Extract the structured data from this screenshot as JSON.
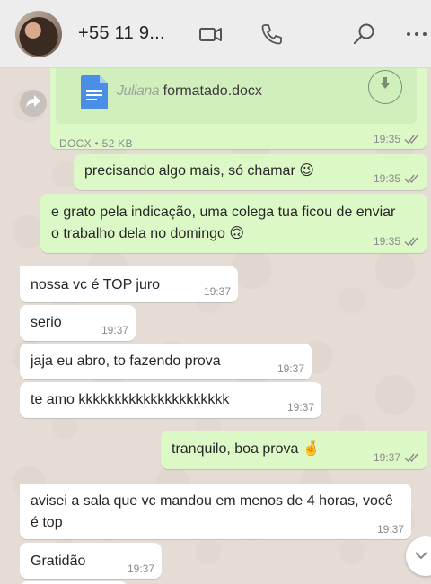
{
  "header": {
    "contact_name": "+55 11 9...",
    "icons": [
      "video-call-icon",
      "voice-call-icon",
      "search-icon",
      "menu-icon"
    ]
  },
  "document": {
    "name_hidden": "Juliana",
    "name_visible": " formatado.docx",
    "type": "DOCX",
    "separator": "•",
    "size": "52 KB",
    "time": "19:35"
  },
  "messages": [
    {
      "direction": "out",
      "text": "precisando algo mais, só chamar 😉",
      "time": "19:35"
    },
    {
      "direction": "out",
      "text": "e grato pela indicação, uma colega tua ficou de enviar o trabalho dela no domingo 🙃",
      "time": "19:35"
    },
    {
      "direction": "in",
      "text": "nossa vc é TOP juro",
      "time": "19:37"
    },
    {
      "direction": "in",
      "text": "serio",
      "time": "19:37"
    },
    {
      "direction": "in",
      "text": "jaja eu abro, to fazendo prova",
      "time": "19:37"
    },
    {
      "direction": "in",
      "text": "te amo kkkkkkkkkkkkkkkkkkkkk",
      "time": "19:37"
    },
    {
      "direction": "out",
      "text": "tranquilo, boa prova 🤞",
      "time": "19:37"
    },
    {
      "direction": "in",
      "text": "avisei a sala que vc mandou em menos de 4 horas, você é top",
      "time": "19:37"
    },
    {
      "direction": "in",
      "text": "Gratidão",
      "time": "19:37"
    }
  ],
  "colors": {
    "outgoing_bubble": "#dcf8c6",
    "incoming_bubble": "#ffffff",
    "chat_background": "#e5ddd5",
    "header_background": "#ededed"
  }
}
